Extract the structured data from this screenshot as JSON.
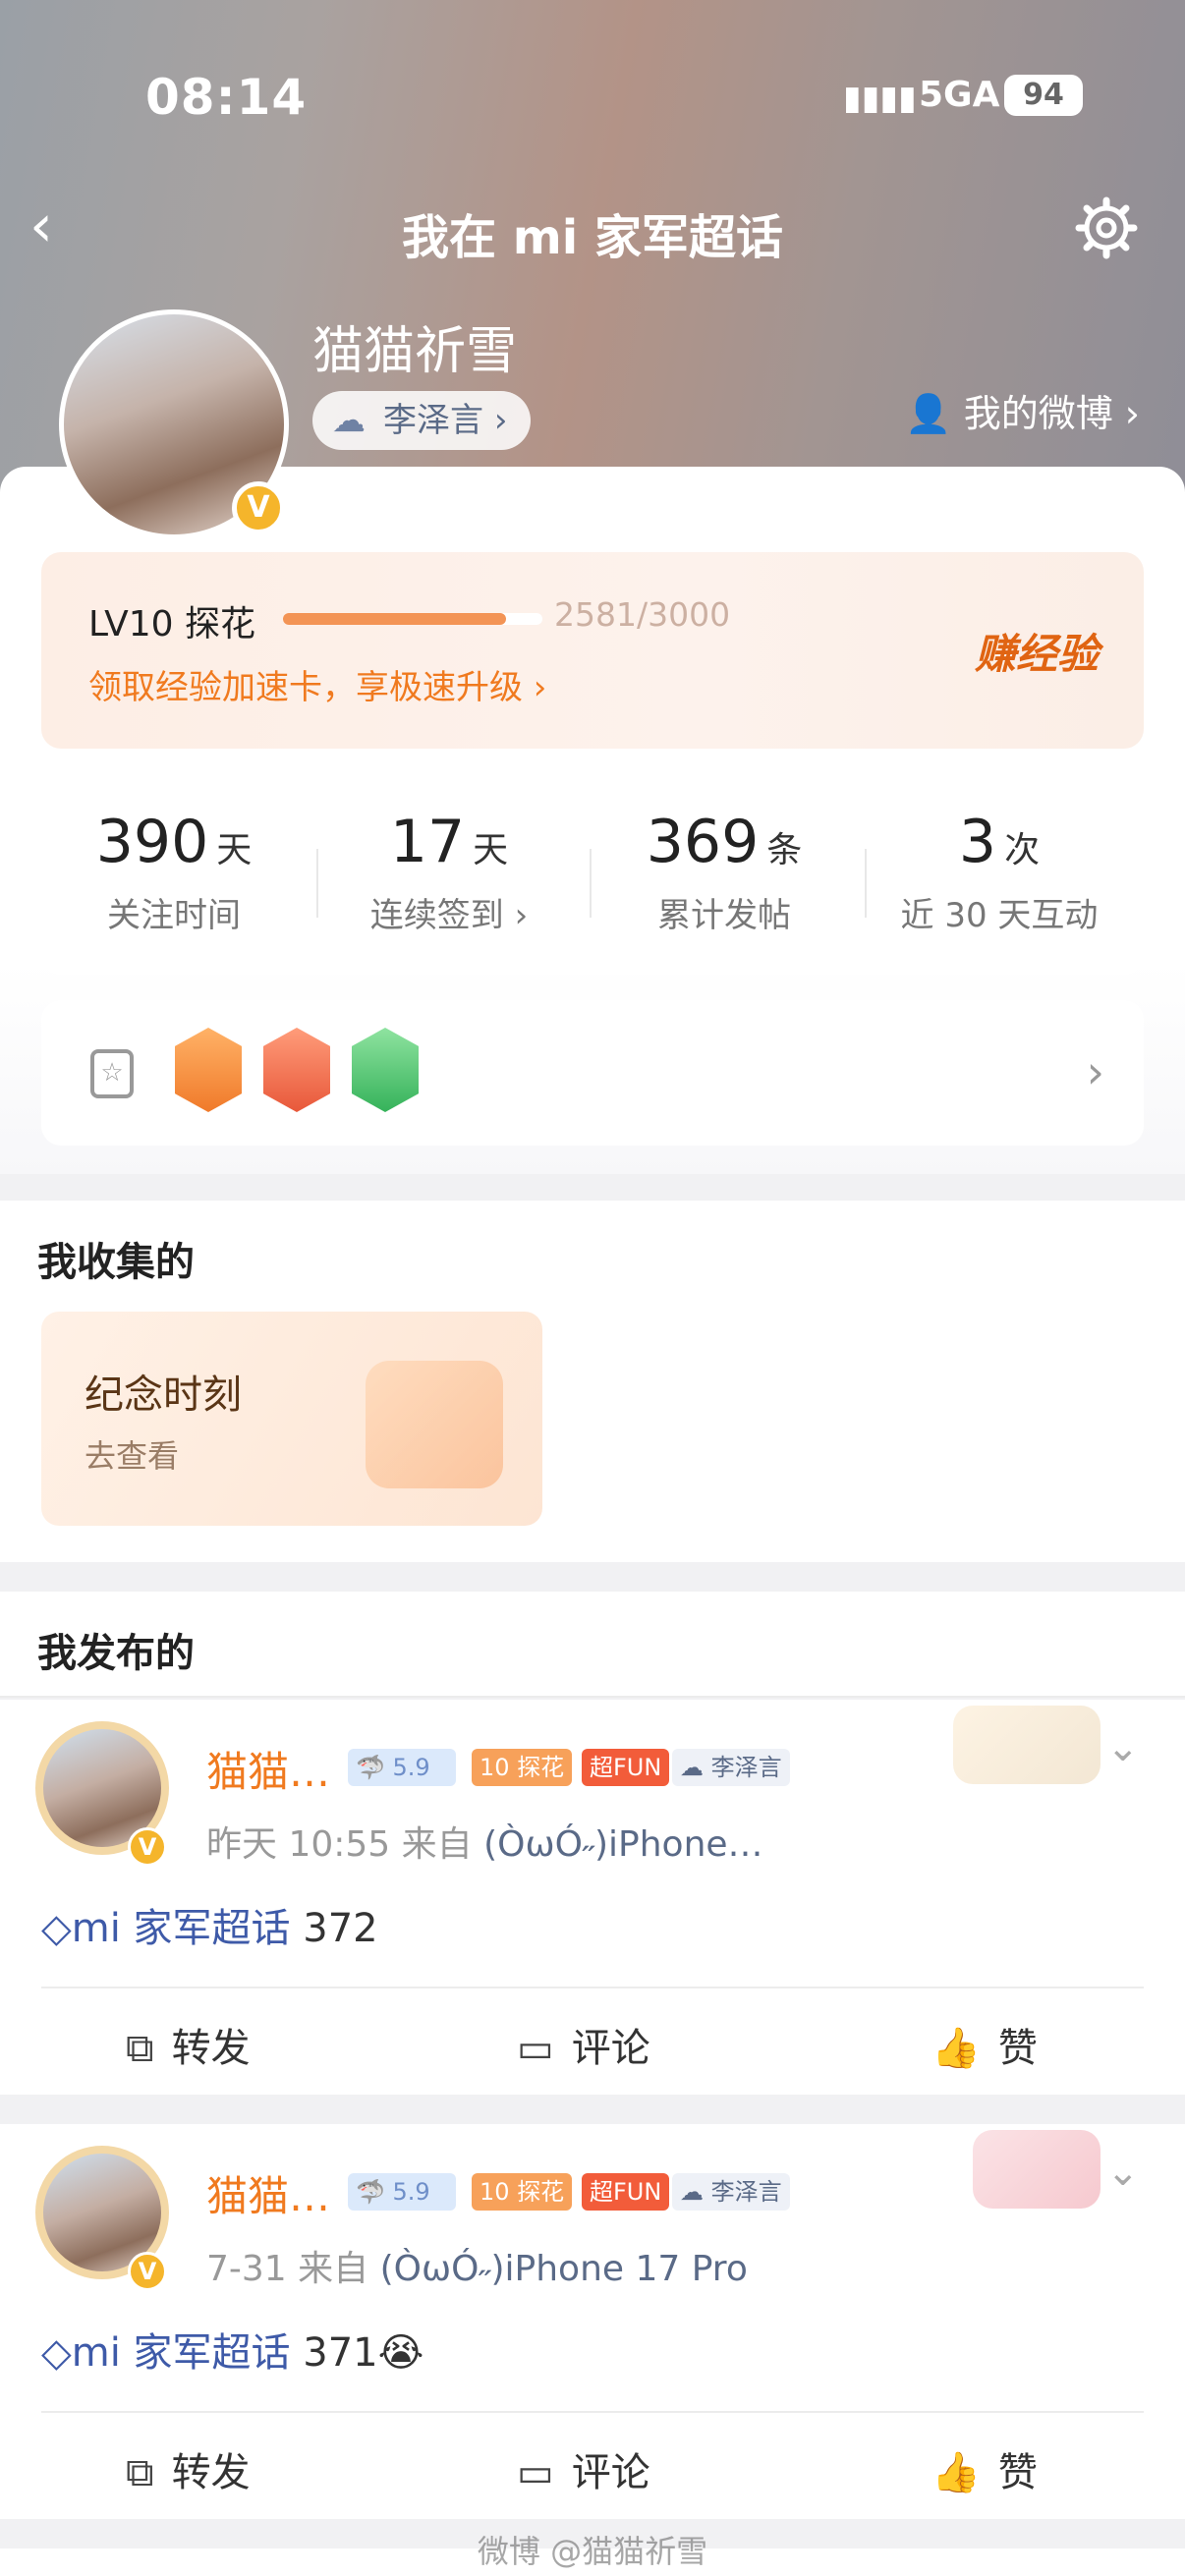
{
  "status": {
    "time": "08:14",
    "network": "5GA",
    "battery": "94"
  },
  "nav": {
    "title": "我在 mi 家军超话"
  },
  "profile": {
    "name": "猫猫祈雪",
    "tag": "李泽言",
    "my_weibo": "我的微博"
  },
  "level": {
    "label": "LV10 探花",
    "progress_text": "2581/3000",
    "progress": 0.86,
    "link": "领取经验加速卡，享极速升级",
    "earn": "赚经验"
  },
  "stats": [
    {
      "value": "390",
      "unit": "天",
      "label": "关注时间"
    },
    {
      "value": "17",
      "unit": "天",
      "label": "连续签到"
    },
    {
      "value": "369",
      "unit": "条",
      "label": "累计发帖"
    },
    {
      "value": "3",
      "unit": "次",
      "label": "近 30 天互动"
    }
  ],
  "collect": {
    "title": "我收集的",
    "card_title": "纪念时刻",
    "card_sub": "去查看"
  },
  "published": {
    "title": "我发布的"
  },
  "posts": [
    {
      "name": "猫猫…",
      "lv_badge": "探花",
      "lv_num": "10",
      "fun_badge": "超FUN",
      "tag": "李泽言",
      "time": "昨天 10:55",
      "from": "来自",
      "source": "(ÒωÓ˶)iPhone…",
      "topic": "mi 家军超话",
      "text": "372"
    },
    {
      "name": "猫猫…",
      "lv_badge": "探花",
      "lv_num": "10",
      "fun_badge": "超FUN",
      "tag": "李泽言",
      "time": "7-31",
      "from": "来自",
      "source": "(ÒωÓ˶)iPhone 17 Pro",
      "topic": "mi 家军超话",
      "text": "371😭"
    }
  ],
  "actions": {
    "repost": "转发",
    "comment": "评论",
    "like": "赞"
  },
  "watermark": "微博 @猫猫祈雪"
}
